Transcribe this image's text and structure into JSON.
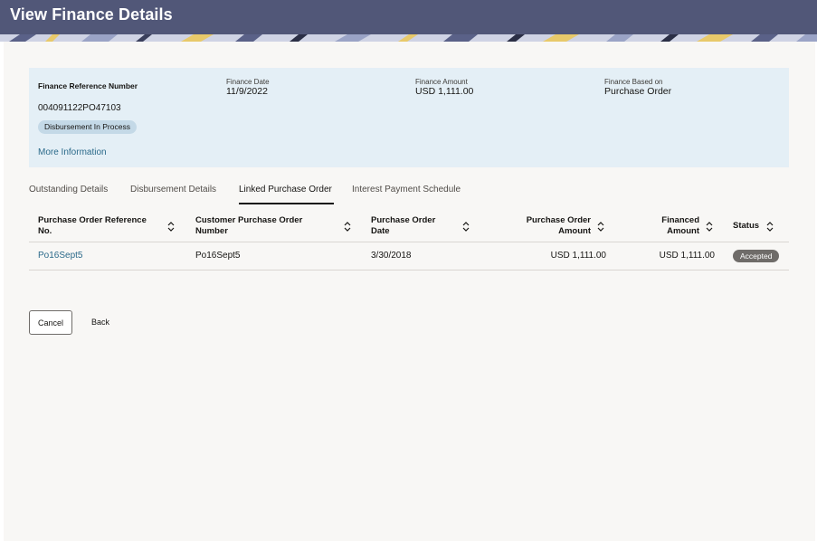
{
  "page": {
    "title": "View Finance Details"
  },
  "summary": {
    "reference": {
      "label": "Finance Reference Number",
      "value": "004091122PO47103"
    },
    "status": "Disbursement In Process",
    "more_info": "More Information",
    "finance_date": {
      "label": "Finance Date",
      "value": "11/9/2022"
    },
    "finance_amount": {
      "label": "Finance Amount",
      "value": "USD 1,111.00"
    },
    "finance_based_on": {
      "label": "Finance Based on",
      "value": "Purchase Order"
    }
  },
  "tabs": [
    {
      "label": "Outstanding Details",
      "active": false
    },
    {
      "label": "Disbursement Details",
      "active": false
    },
    {
      "label": "Linked Purchase Order",
      "active": true
    },
    {
      "label": "Interest Payment Schedule",
      "active": false
    }
  ],
  "table": {
    "columns": [
      {
        "line1": "Purchase Order Reference",
        "line2": "No."
      },
      {
        "line1": "Customer Purchase Order",
        "line2": "Number"
      },
      {
        "line1": "Purchase Order",
        "line2": "Date"
      },
      {
        "line1": "Purchase Order",
        "line2": "Amount"
      },
      {
        "line1": "Financed",
        "line2": "Amount"
      },
      {
        "line1": "Status",
        "line2": ""
      }
    ],
    "rows": [
      {
        "po_reference": "Po16Sept5",
        "customer_po_number": "Po16Sept5",
        "po_date": "3/30/2018",
        "po_amount": "USD 1,111.00",
        "financed_amount": "USD 1,111.00",
        "status": "Accepted"
      }
    ]
  },
  "actions": {
    "cancel": "Cancel",
    "back": "Back"
  },
  "colors": {
    "header": "#515778",
    "summary_bg": "#e4eff6",
    "link": "#2b6a8a",
    "badge": "#6f6c69"
  }
}
